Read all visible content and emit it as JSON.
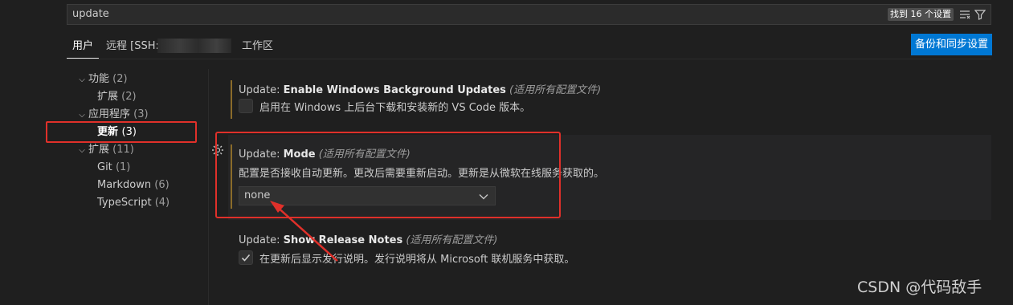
{
  "search": {
    "value": "update",
    "result_count": "找到 16 个设置"
  },
  "tabs": {
    "user": "用户",
    "remote": "远程 [SSH:",
    "workspace": "工作区"
  },
  "sync_button": "备份和同步设置",
  "tree": [
    {
      "label": "功能",
      "count": "(2)",
      "level": 0,
      "expanded": true
    },
    {
      "label": "扩展",
      "count": "(2)",
      "level": 1
    },
    {
      "label": "应用程序",
      "count": "(3)",
      "level": 0,
      "expanded": true
    },
    {
      "label": "更新",
      "count": "(3)",
      "level": 1,
      "active": true
    },
    {
      "label": "扩展",
      "count": "(11)",
      "level": 0,
      "expanded": true
    },
    {
      "label": "Git",
      "count": "(1)",
      "level": 1
    },
    {
      "label": "Markdown",
      "count": "(6)",
      "level": 1
    },
    {
      "label": "TypeScript",
      "count": "(4)",
      "level": 1
    }
  ],
  "settings": {
    "background": {
      "prefix": "Update: ",
      "name": "Enable Windows Background Updates",
      "scope": "(适用所有配置文件)",
      "description": "启用在 Windows 上后台下载和安装新的 VS Code 版本。",
      "checked": false
    },
    "mode": {
      "prefix": "Update: ",
      "name": "Mode",
      "scope": "(适用所有配置文件)",
      "description": "配置是否接收自动更新。更改后需要重新启动。更新是从微软在线服务获取的。",
      "value": "none"
    },
    "release_notes": {
      "prefix": "Update: ",
      "name": "Show Release Notes",
      "scope": "(适用所有配置文件)",
      "description": "在更新后显示发行说明。发行说明将从 Microsoft 联机服务中获取。",
      "checked": true
    }
  },
  "watermark": "CSDN @代码敌手",
  "icons": {
    "clear": "clear-filter-icon",
    "filter": "filter-icon",
    "gear": "gear-icon",
    "chevron": "chevron-down-icon",
    "check": "check-icon"
  },
  "colors": {
    "accent": "#0078d4",
    "annotation_red": "#e0302a",
    "modified_bar": "#8a6b2a"
  }
}
